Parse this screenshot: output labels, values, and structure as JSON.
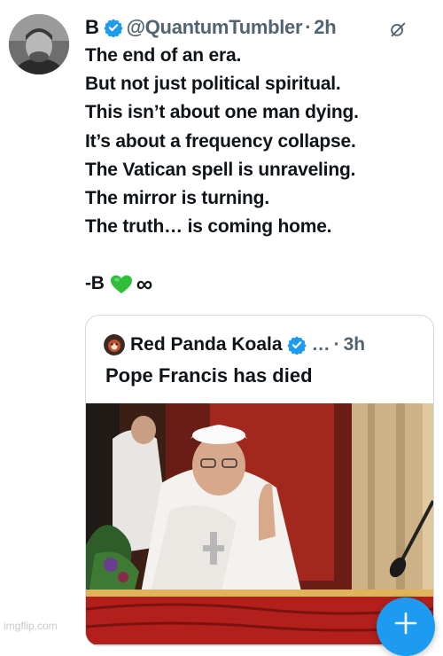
{
  "tweet": {
    "author_name": "B",
    "handle": "@QuantumTumbler",
    "separator": "·",
    "time": "2h",
    "lines": [
      "The end of an era.",
      "But not just political spiritual.",
      "This isn’t about one man dying.",
      "It’s about a frequency collapse.",
      "The Vatican spell is unraveling.",
      "The mirror is turning.",
      "The truth… is coming home."
    ],
    "signature": "-B",
    "signature_emoji": "green-heart",
    "signature_symbol": "∞"
  },
  "quoted_tweet": {
    "author_name": "Red Panda Koala",
    "ellipsis": "…",
    "separator": "·",
    "time": "3h",
    "text": "Pope Francis has died",
    "media_icon": "photo"
  },
  "watermark": "imgflip.com",
  "colors": {
    "text": "#0f1419",
    "muted": "#536471",
    "verified": "#1d9bf0",
    "heart": "#2fbf3a",
    "fab": "#1d9bf0"
  },
  "icons": [
    "verified-badge-icon",
    "grok-icon",
    "green-heart-icon",
    "plus-icon"
  ]
}
